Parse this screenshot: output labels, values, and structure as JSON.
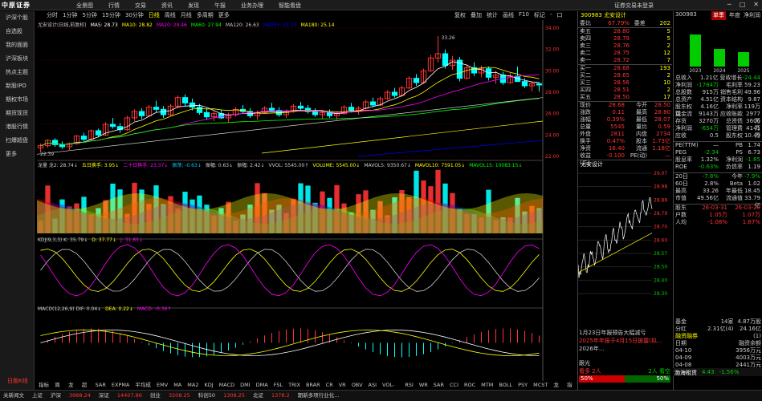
{
  "app": {
    "logo": "中原证券"
  },
  "menu": [
    "全景图",
    "行情",
    "交易",
    "资讯",
    "发现",
    "午报",
    "业务办理",
    "智能看盘"
  ],
  "trade_status": "证券交易未登录",
  "sidebar": [
    "沪深个股",
    "自选股",
    "我的面面",
    "沪深板块",
    "热点主题",
    "新股IPO",
    "期权市场",
    "期货现货",
    "港股行情",
    "扫爆超盘",
    "更多"
  ],
  "sidebar_footer": "日版K线",
  "periods": [
    "分时",
    "1分钟",
    "5分钟",
    "15分钟",
    "30分钟",
    "日线",
    "周线",
    "月线",
    "多周期",
    "更多"
  ],
  "active_period": "日线",
  "tools": [
    "复权",
    "叠加",
    "统计",
    "画线",
    "F10",
    "标记",
    "-",
    "口"
  ],
  "stock": {
    "name": "尤安设计(日线,前复权)",
    "code": "300983",
    "short": "尤安设计"
  },
  "ma_legend": [
    {
      "t": "MA5: 28.73",
      "c": "#fff"
    },
    {
      "t": "MA10: 28.82",
      "c": "#ff0"
    },
    {
      "t": "MA20: 29.46",
      "c": "#f0f"
    },
    {
      "t": "MA60: 27.94",
      "c": "#0f0"
    },
    {
      "t": "MA120: 26.63",
      "c": "#ccc"
    },
    {
      "t": "MA250: 22.03",
      "c": "#00f"
    },
    {
      "t": "MA180: 25.14",
      "c": "#ff0"
    }
  ],
  "price_labels": {
    "high": "33.26",
    "low": "22.39"
  },
  "vol_legend": [
    {
      "t": "龙量 龙2: 28.74↓",
      "c": "#ccc"
    },
    {
      "t": "五日换手: 3.95↓",
      "c": "#ff0"
    },
    {
      "t": "二十日换手: 23.37↓",
      "c": "#f0f"
    },
    {
      "t": "振荡: -0.63↓",
      "c": "#0cf"
    },
    {
      "t": "振幅: 0.63↓",
      "c": "#ccc"
    },
    {
      "t": "振幅: 2.42↓",
      "c": "#ccc"
    },
    {
      "t": "VVOL: 5545.00↑",
      "c": "#ccc"
    },
    {
      "t": "VOLUME: 5545.00↓",
      "c": "#ff0"
    },
    {
      "t": "MAVOL5: 9350.67↓",
      "c": "#ccc"
    },
    {
      "t": "MAVOL10: 7591.05↓",
      "c": "#ff0"
    },
    {
      "t": "MAVOL15: 10083.15↓",
      "c": "#0f0"
    }
  ],
  "kdj_legend": [
    {
      "t": "KDJ(9,3,3) K: 35.79↓",
      "c": "#ccc"
    },
    {
      "t": "D: 37.77↓",
      "c": "#ff0"
    },
    {
      "t": "J: 31.85↓",
      "c": "#f0f"
    }
  ],
  "macd_legend": [
    {
      "t": "MACD(12,26,9) DIF: 0.04↓",
      "c": "#ccc"
    },
    {
      "t": "DEA: 0.22↓",
      "c": "#ff0"
    },
    {
      "t": "MACD: -0.36↑",
      "c": "#f0f"
    }
  ],
  "indicators": [
    "指标A",
    "周期",
    "龙量",
    "超赚",
    "SAR",
    "EXPMA",
    "平均成本",
    "EMV",
    "MA",
    "MA2",
    "KDJ",
    "MACD",
    "DMI",
    "DMA",
    "FSL",
    "TRIX",
    "BRAR",
    "CR",
    "VR",
    "OBV",
    "ASI",
    "VOL-TDX",
    "RSI",
    "WR",
    "SAR",
    "CCI",
    "ROC",
    "MTM",
    "BOLL",
    "PSY",
    "MCST",
    "龙线",
    "指标"
  ],
  "quote": {
    "title": "300983 尤安设计",
    "ratio": {
      "l": "委比",
      "m": "67.79%",
      "r": "委差",
      "rv": "202"
    },
    "asks": [
      {
        "l": "卖五",
        "p": "28.80",
        "v": "5"
      },
      {
        "l": "卖四",
        "p": "28.79",
        "v": "5"
      },
      {
        "l": "卖三",
        "p": "28.76",
        "v": "2"
      },
      {
        "l": "卖二",
        "p": "28.75",
        "v": "12"
      },
      {
        "l": "卖一",
        "p": "28.72",
        "v": "7"
      }
    ],
    "bids": [
      {
        "l": "买一",
        "p": "28.68",
        "v": "193"
      },
      {
        "l": "买二",
        "p": "28.65",
        "v": "2"
      },
      {
        "l": "买三",
        "p": "28.56",
        "v": "10"
      },
      {
        "l": "买四",
        "p": "28.51",
        "v": "2"
      },
      {
        "l": "买五",
        "p": "28.50",
        "v": "17"
      }
    ],
    "stats": [
      {
        "a": "现价",
        "av": "28.68",
        "b": "今开",
        "bv": "28.50"
      },
      {
        "a": "涨跌",
        "av": "0.11",
        "b": "最高",
        "bv": "28.80"
      },
      {
        "a": "涨幅",
        "av": "0.39%",
        "b": "最低",
        "bv": "28.07"
      },
      {
        "a": "总量",
        "av": "5545",
        "b": "量比",
        "bv": "0.59"
      },
      {
        "a": "外盘",
        "av": "2811",
        "b": "内盘",
        "bv": "2734"
      },
      {
        "a": "换手",
        "av": "0.47%",
        "b": "股本",
        "bv": "1.73亿"
      },
      {
        "a": "净资",
        "av": "16.40",
        "b": "流通",
        "bv": "1.18亿"
      },
      {
        "a": "收益(二)",
        "av": "-0.100",
        "b": "PE(动)",
        "bv": "—"
      }
    ],
    "mini_name": "尤安设计",
    "mini_axis": [
      "29.07",
      "28.98",
      "28.88",
      "28.79",
      "28.70",
      "28.60",
      "28.57",
      "28.50",
      "28.40",
      "28.30"
    ]
  },
  "fin": {
    "code": "300983",
    "tabs": [
      "单季",
      "年度",
      "净利润"
    ],
    "years": [
      "2023",
      "2024",
      "2025"
    ],
    "rows": [
      {
        "l": "总收入",
        "v": "1.21亿",
        "l2": "营收增长",
        "v2": "-24.44"
      },
      {
        "l": "净利润",
        "v": "-1784万",
        "l2": "毛利率",
        "v2": "59.23"
      },
      {
        "l": "总股数",
        "v": "915万",
        "l2": "销售毛利",
        "v2": "49.96"
      },
      {
        "l": "总资产",
        "v": "4.51亿",
        "l2": "资本结构",
        "v2": "9.87"
      },
      {
        "l": "股东权益",
        "v": "4.16亿",
        "l2": "净利率",
        "v2": "119万"
      },
      {
        "l": "现金流",
        "v": "9143万",
        "l2": "应收账款",
        "v2": "2977万"
      },
      {
        "l": "存货",
        "v": "3270万",
        "l2": "总资债",
        "v2": "3606万"
      },
      {
        "l": "净利润",
        "v": "-654万",
        "l2": "管理费",
        "v2": "4141万"
      },
      {
        "l": "应收",
        "v": "0.5",
        "l2": "股东权",
        "v2": "10.49"
      }
    ],
    "pe_rows": [
      {
        "l": "PE(TTM)",
        "v": "—",
        "l2": "PB",
        "v2": "1.74"
      },
      {
        "l": "PEG",
        "v": "-2.34",
        "l2": "PS",
        "v2": "6.73"
      },
      {
        "l": "股息率",
        "v": "1.32%",
        "l2": "净利润",
        "v2": "-1.85"
      },
      {
        "l": "ROE",
        "v": "-0.63%",
        "l2": "负债率",
        "v2": "1.19"
      }
    ],
    "more": [
      {
        "l": "20日",
        "v": "-7.8%",
        "l2": "今年",
        "v2": "-7.9%"
      },
      {
        "l": "60日",
        "v": "2.8%",
        "l2": "Beta",
        "v2": "1.02"
      },
      {
        "l": "最高",
        "v": "33.26",
        "l2": "年最低",
        "v2": "18.45"
      },
      {
        "l": "市值",
        "v": "49.56亿",
        "l2": "流通值",
        "v2": "33.79亿"
      }
    ],
    "holder": [
      {
        "l": "股东",
        "v": "26-03-31",
        "v2": "26-03-20"
      },
      {
        "l": "户数",
        "v": "1.05万",
        "v2": "1.07万"
      },
      {
        "l": "人均",
        "v": "-1.08%",
        "v2": "1.87%"
      }
    ],
    "ticker": {
      "name": "渤海租赁",
      "p": "4.43",
      "c": "-1.56%"
    },
    "lhb": [
      {
        "d": "04-10",
        "v": "3956万元"
      },
      {
        "d": "04-09",
        "v": "4003万元"
      },
      {
        "d": "04-08",
        "v": "2441万元"
      }
    ],
    "lhb_header": {
      "l": "日期",
      "v": "融资余额"
    },
    "lhb_title": "融资融券",
    "fund": {
      "l": "基金",
      "v": "14家",
      "v2": "4.87万股"
    },
    "fund2": {
      "l": "分红",
      "v": "2.31亿(4)",
      "v2": "24.16亿(1)"
    }
  },
  "news": [
    {
      "t": "1月23日年报预告大幅减亏",
      "c": "#ccc"
    },
    {
      "t": "2025年年报于4月15日披露(拟...",
      "c": "#f33"
    },
    {
      "t": "2026年...",
      "c": "#ccc"
    }
  ],
  "mini_rank": {
    "l": "跟光",
    "v": "看多 2人",
    "r": "2人 看空"
  },
  "mini_pct": {
    "a": "50%",
    "b": "50%"
  },
  "status": [
    {
      "t": "关新闻文",
      "c": "#ccc"
    },
    {
      "t": "上证",
      "c": "#ccc"
    },
    {
      "t": "沪深",
      "c": "#ccc"
    },
    {
      "t": "3988.24",
      "c": "#f33"
    },
    {
      "t": "深证",
      "c": "#ccc"
    },
    {
      "t": "14407.86",
      "c": "#f33"
    },
    {
      "t": "创业",
      "c": "#ccc"
    },
    {
      "t": "3208.25",
      "c": "#f33"
    },
    {
      "t": "科创50",
      "c": "#ccc"
    },
    {
      "t": "1308.25",
      "c": "#f33"
    },
    {
      "t": "北证",
      "c": "#ccc"
    },
    {
      "t": "1378.2",
      "c": "#f33"
    },
    {
      "t": "期新多项行业化...",
      "c": "#ccc"
    }
  ],
  "chart_data": {
    "type": "candlestick",
    "ylim": [
      22.0,
      34.0
    ],
    "candles": [
      [
        22.8,
        23.2,
        22.4,
        23.0
      ],
      [
        23.0,
        23.6,
        22.8,
        23.5
      ],
      [
        23.5,
        23.7,
        22.9,
        23.1
      ],
      [
        23.1,
        23.4,
        22.7,
        22.9
      ],
      [
        22.9,
        23.3,
        22.6,
        23.2
      ],
      [
        23.2,
        24.0,
        23.1,
        23.9
      ],
      [
        23.9,
        24.2,
        23.4,
        23.6
      ],
      [
        23.6,
        24.5,
        23.5,
        24.4
      ],
      [
        24.4,
        24.6,
        23.8,
        24.0
      ],
      [
        24.0,
        25.2,
        23.9,
        25.0
      ],
      [
        25.0,
        25.6,
        24.6,
        24.8
      ],
      [
        24.8,
        25.1,
        24.2,
        24.5
      ],
      [
        24.5,
        25.8,
        24.4,
        25.6
      ],
      [
        25.6,
        26.4,
        25.3,
        26.2
      ],
      [
        26.2,
        26.5,
        25.5,
        25.8
      ],
      [
        25.8,
        26.8,
        25.7,
        26.6
      ],
      [
        26.6,
        27.2,
        26.1,
        26.4
      ],
      [
        26.4,
        26.7,
        25.6,
        25.9
      ],
      [
        25.9,
        26.9,
        25.8,
        26.7
      ],
      [
        26.7,
        27.7,
        26.5,
        27.5
      ],
      [
        27.5,
        27.8,
        26.7,
        27.0
      ],
      [
        27.0,
        27.4,
        26.3,
        26.6
      ],
      [
        26.6,
        26.9,
        25.9,
        26.1
      ],
      [
        26.1,
        26.5,
        25.4,
        25.7
      ],
      [
        25.7,
        26.2,
        25.3,
        26.0
      ],
      [
        26.0,
        26.4,
        25.5,
        25.6
      ],
      [
        25.6,
        26.1,
        25.2,
        25.9
      ],
      [
        25.9,
        26.6,
        25.7,
        26.4
      ],
      [
        26.4,
        26.8,
        26.0,
        26.2
      ],
      [
        26.2,
        26.5,
        25.6,
        25.8
      ],
      [
        25.8,
        26.3,
        25.4,
        26.1
      ],
      [
        26.1,
        26.7,
        26.0,
        26.5
      ],
      [
        26.5,
        27.0,
        26.2,
        26.3
      ],
      [
        26.3,
        26.6,
        25.7,
        25.9
      ],
      [
        25.9,
        26.4,
        25.6,
        26.2
      ],
      [
        26.2,
        26.9,
        26.1,
        26.7
      ],
      [
        26.7,
        27.1,
        26.3,
        26.5
      ],
      [
        26.5,
        26.8,
        26.0,
        26.2
      ],
      [
        26.2,
        26.5,
        25.7,
        25.9
      ],
      [
        25.9,
        26.3,
        25.5,
        26.1
      ],
      [
        26.1,
        26.4,
        25.6,
        25.8
      ],
      [
        25.8,
        26.2,
        25.4,
        26.0
      ],
      [
        26.0,
        26.8,
        25.9,
        26.6
      ],
      [
        26.6,
        27.0,
        26.1,
        26.3
      ],
      [
        26.3,
        26.7,
        25.9,
        26.5
      ],
      [
        26.5,
        27.3,
        26.4,
        27.1
      ],
      [
        27.1,
        27.5,
        26.6,
        26.8
      ],
      [
        26.8,
        27.6,
        26.7,
        27.4
      ],
      [
        27.4,
        28.2,
        27.3,
        28.0
      ],
      [
        28.0,
        28.4,
        27.5,
        27.7
      ],
      [
        27.7,
        28.6,
        27.6,
        28.4
      ],
      [
        28.4,
        29.5,
        28.3,
        29.3
      ],
      [
        29.3,
        29.7,
        28.6,
        28.9
      ],
      [
        28.9,
        30.2,
        28.8,
        30.0
      ],
      [
        30.0,
        31.5,
        29.9,
        31.2
      ],
      [
        31.2,
        33.26,
        30.8,
        31.6
      ],
      [
        31.6,
        32.0,
        30.2,
        30.5
      ],
      [
        30.5,
        31.4,
        30.1,
        31.0
      ],
      [
        31.0,
        31.3,
        29.0,
        29.3
      ],
      [
        29.3,
        30.6,
        29.2,
        30.3
      ],
      [
        30.3,
        30.8,
        29.5,
        29.8
      ],
      [
        29.8,
        30.5,
        29.4,
        30.2
      ],
      [
        30.2,
        30.4,
        29.1,
        29.4
      ],
      [
        29.4,
        30.0,
        28.8,
        29.6
      ],
      [
        29.6,
        29.9,
        28.7,
        28.9
      ],
      [
        28.9,
        29.8,
        28.8,
        29.5
      ],
      [
        29.5,
        30.4,
        29.3,
        29.0
      ],
      [
        29.0,
        29.3,
        28.4,
        28.6
      ],
      [
        28.6,
        29.0,
        28.1,
        28.8
      ],
      [
        28.8,
        28.9,
        28.07,
        28.68
      ]
    ]
  }
}
